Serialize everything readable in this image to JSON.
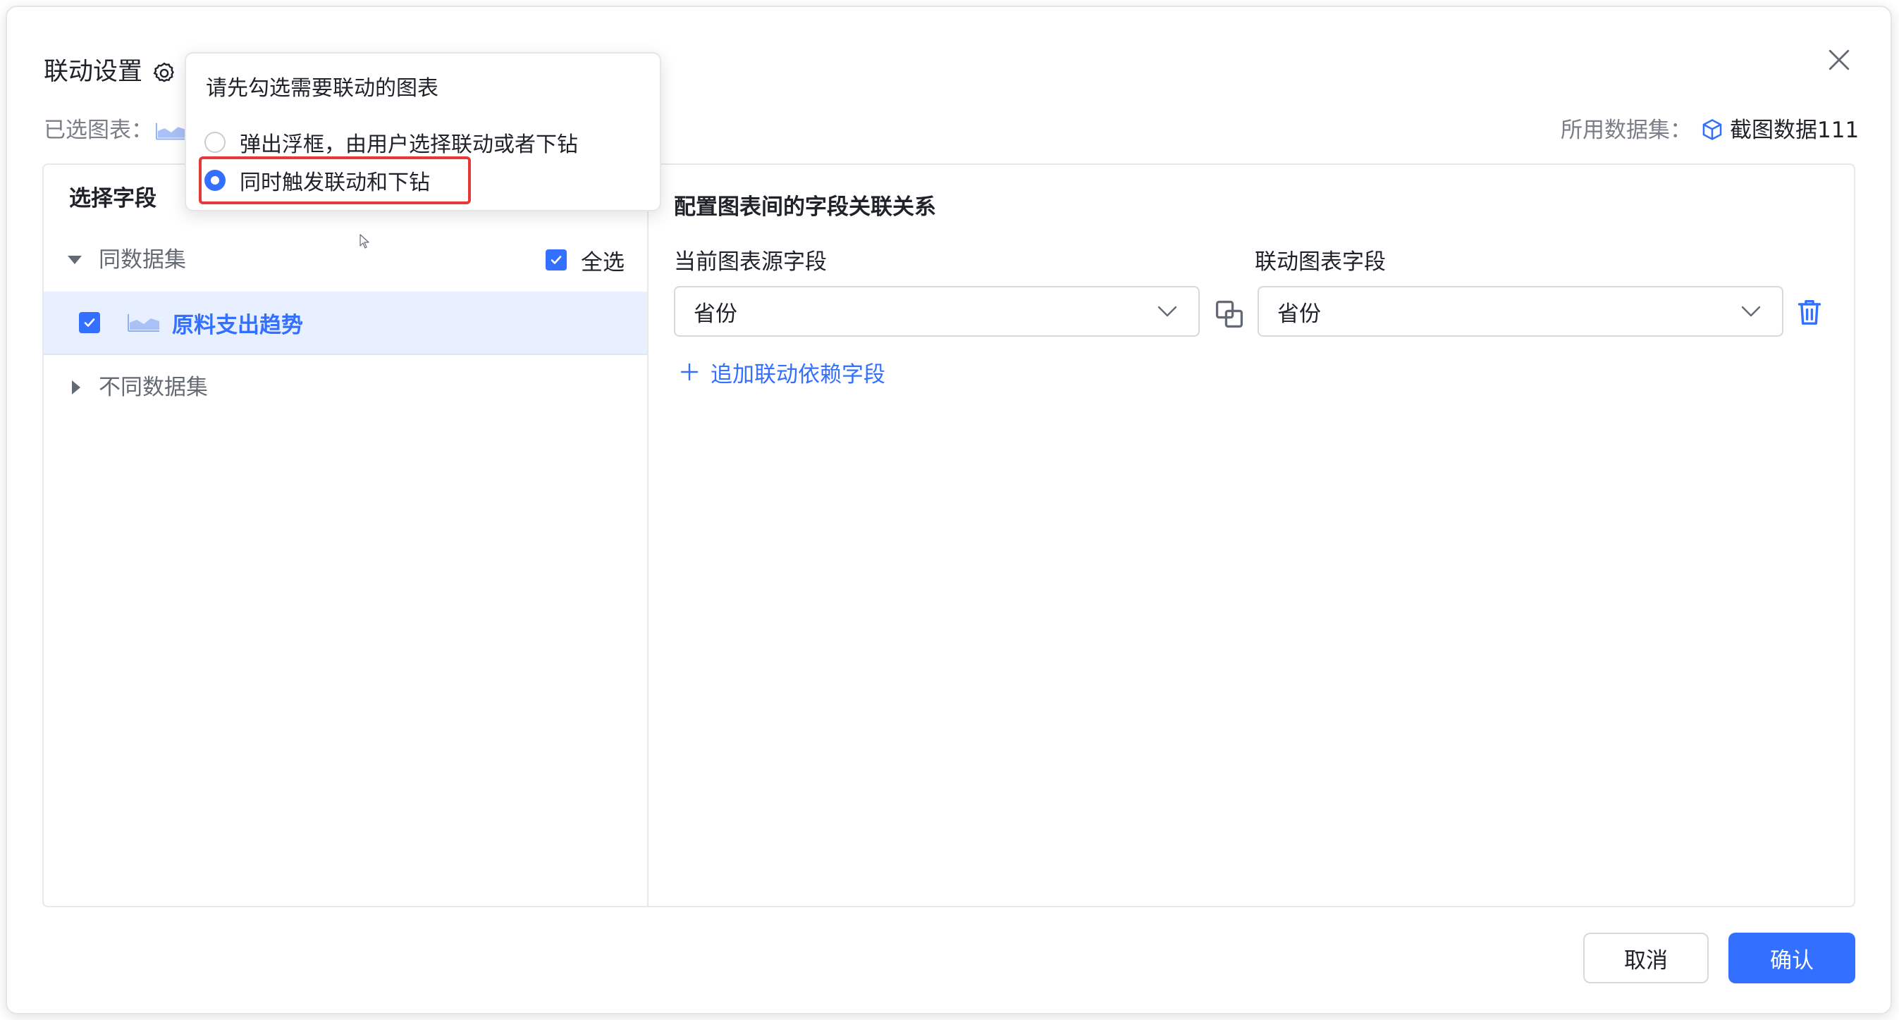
{
  "dialog": {
    "title": "联动设置",
    "selected_charts_label": "已选图表：",
    "dataset_label": "所用数据集：",
    "dataset_name": "截图数据111"
  },
  "popover": {
    "title": "请先勾选需要联动的图表",
    "options": [
      {
        "label": "弹出浮框，由用户选择联动或者下钻",
        "checked": false
      },
      {
        "label": "同时触发联动和下钻",
        "checked": true
      }
    ]
  },
  "left_panel": {
    "title": "选择字段",
    "same_dataset_label": "同数据集",
    "select_all_label": "全选",
    "charts": [
      {
        "name": "原料支出趋势",
        "checked": true
      }
    ],
    "diff_dataset_label": "不同数据集"
  },
  "right_panel": {
    "title": "配置图表间的字段关联关系",
    "source_label": "当前图表源字段",
    "target_label": "联动图表字段",
    "rows": [
      {
        "source": "省份",
        "target": "省份"
      }
    ],
    "add_label": "追加联动依赖字段"
  },
  "footer": {
    "cancel_label": "取消",
    "ok_label": "确认"
  },
  "colors": {
    "accent": "#3370ff",
    "highlight": "#e53935",
    "selected_row_bg": "#e8effe"
  },
  "icons": [
    "gear-icon",
    "close-icon",
    "area-chart-icon",
    "cube-icon",
    "link-icon",
    "trash-icon",
    "plus-icon",
    "chevron-down-icon",
    "checkbox-checked-icon"
  ]
}
